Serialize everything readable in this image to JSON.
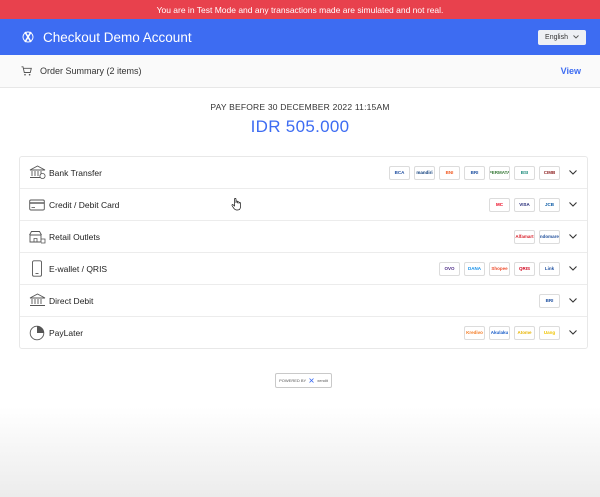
{
  "banner": {
    "text": "You are in Test Mode and any transactions made are simulated and not real."
  },
  "header": {
    "account_name": "Checkout Demo Account",
    "language": "English"
  },
  "summary": {
    "label": "Order Summary (2 items)",
    "view_label": "View"
  },
  "payment": {
    "due_text": "PAY BEFORE 30 DECEMBER 2022 11:15AM",
    "amount": "IDR 505.000"
  },
  "methods": [
    {
      "label": "Bank Transfer",
      "icon": "bank-icon",
      "logos": [
        {
          "text": "BCA",
          "color": "#1a4a9e"
        },
        {
          "text": "mandiri",
          "color": "#0b3b7a"
        },
        {
          "text": "BNI",
          "color": "#f15a22"
        },
        {
          "text": "BRI",
          "color": "#1d4fa0"
        },
        {
          "text": "PERMATA",
          "color": "#3a7b3a"
        },
        {
          "text": "BSI",
          "color": "#1a8a7a"
        },
        {
          "text": "CIMB",
          "color": "#8b1c1c"
        }
      ]
    },
    {
      "label": "Credit / Debit Card",
      "icon": "credit-card-icon",
      "logos": [
        {
          "text": "MC",
          "color": "#eb001b"
        },
        {
          "text": "VISA",
          "color": "#1a1f71"
        },
        {
          "text": "JCB",
          "color": "#0a5aa5"
        }
      ]
    },
    {
      "label": "Retail Outlets",
      "icon": "retail-outlet-icon",
      "logos": [
        {
          "text": "Alfamart",
          "color": "#d9232d"
        },
        {
          "text": "Indomaret",
          "color": "#1f4e9a"
        }
      ]
    },
    {
      "label": "E-wallet / QRIS",
      "icon": "ewallet-icon",
      "logos": [
        {
          "text": "OVO",
          "color": "#4c2a86"
        },
        {
          "text": "DANA",
          "color": "#118eea"
        },
        {
          "text": "Shopee",
          "color": "#ee4d2d"
        },
        {
          "text": "QRIS",
          "color": "#d0021b"
        },
        {
          "text": "Link",
          "color": "#1d4fa0"
        }
      ]
    },
    {
      "label": "Direct Debit",
      "icon": "direct-debit-icon",
      "logos": [
        {
          "text": "BRI",
          "color": "#1d4fa0"
        }
      ]
    },
    {
      "label": "PayLater",
      "icon": "paylater-icon",
      "logos": [
        {
          "text": "Kredivo",
          "color": "#f47920"
        },
        {
          "text": "Akulaku",
          "color": "#1a5ec9"
        },
        {
          "text": "Atome",
          "color": "#e8b400"
        },
        {
          "text": "Uang",
          "color": "#f0c400"
        }
      ]
    }
  ],
  "footer": {
    "powered_label": "POWERED BY",
    "brand": "xendit"
  },
  "colors": {
    "primary": "#3d6cf2",
    "banner": "#e8414d"
  }
}
